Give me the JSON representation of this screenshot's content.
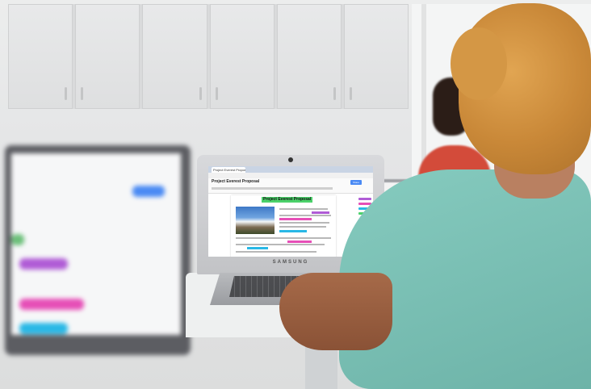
{
  "main_laptop": {
    "brand": "SAMSUNG",
    "browser_tab_title": "Project Everest Proposal",
    "document_title": "Project Everest Proposal",
    "document_heading": "Project Everest Proposal",
    "share_button": "Share"
  },
  "colors": {
    "heading_highlight": "#4bd16a",
    "pink_highlight": "#e64fb7",
    "cyan_highlight": "#29b8e6",
    "purple_highlight": "#b05cd6",
    "kid_shirt": "#7fc4b8",
    "kid2_shirt": "#d34b3a"
  },
  "icons": [
    "camera-icon",
    "mountain-photo"
  ]
}
